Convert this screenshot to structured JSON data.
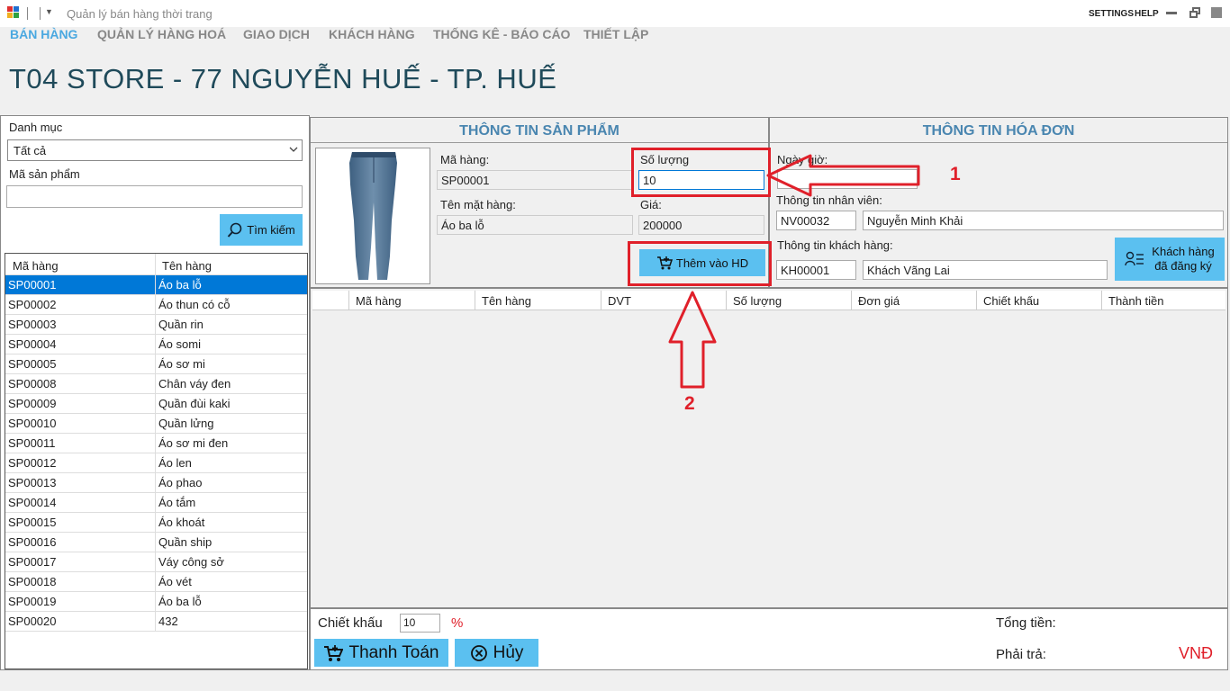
{
  "window": {
    "title": "Quản lý bán hàng thời trang",
    "settings_label": "SETTINGS",
    "help_label": "HELP"
  },
  "menu": [
    {
      "label": "BÁN HÀNG",
      "active": true
    },
    {
      "label": "QUẢN LÝ HÀNG HOÁ",
      "active": false
    },
    {
      "label": "GIAO DỊCH",
      "active": false
    },
    {
      "label": "KHÁCH HÀNG",
      "active": false
    },
    {
      "label": "THỐNG KÊ - BÁO CÁO",
      "active": false
    },
    {
      "label": "THIẾT LẬP",
      "active": false
    }
  ],
  "store_title": "T04 STORE - 77 NGUYỄN HUẾ - TP. HUẾ",
  "left": {
    "category_label": "Danh mục",
    "category_value": "Tất cả",
    "code_label": "Mã sản phẩm",
    "code_value": "",
    "search_button": "Tìm kiếm",
    "table": {
      "headers": [
        "Mã hàng",
        "Tên hàng"
      ],
      "rows": [
        [
          "SP00001",
          "Áo ba lỗ"
        ],
        [
          "SP00002",
          "Áo thun có cỗ"
        ],
        [
          "SP00003",
          "Quần rin"
        ],
        [
          "SP00004",
          "Áo somi"
        ],
        [
          "SP00005",
          "Áo sơ mi"
        ],
        [
          "SP00008",
          "Chân váy đen"
        ],
        [
          "SP00009",
          "Quần đùi kaki"
        ],
        [
          "SP00010",
          "Quần lửng"
        ],
        [
          "SP00011",
          "Áo sơ mi đen"
        ],
        [
          "SP00012",
          "Áo len"
        ],
        [
          "SP00013",
          "Áo phao"
        ],
        [
          "SP00014",
          "Áo tắm"
        ],
        [
          "SP00015",
          "Áo khoát"
        ],
        [
          "SP00016",
          "Quần ship"
        ],
        [
          "SP00017",
          "Váy công sở"
        ],
        [
          "SP00018",
          "Áo vét"
        ],
        [
          "SP00019",
          "Áo ba lỗ"
        ],
        [
          "SP00020",
          "432"
        ]
      ],
      "selected_index": 0
    }
  },
  "product": {
    "header": "THÔNG TIN SẢN PHẨM",
    "code_label": "Mã hàng:",
    "code_value": "SP00001",
    "qty_label": "Số lượng",
    "qty_value": "10",
    "name_label": "Tên mặt hàng:",
    "name_value": "Áo ba lỗ",
    "price_label": "Giá:",
    "price_value": "200000",
    "add_button": "Thêm vào HD"
  },
  "bill": {
    "header": "THÔNG TIN HÓA ĐƠN",
    "datetime_label": "Ngày giờ:",
    "datetime_value": "",
    "staff_label": "Thông tin nhân viên:",
    "staff_id": "NV00032",
    "staff_name": "Nguyễn Minh Khải",
    "customer_label": "Thông tin khách hàng:",
    "customer_id": "KH00001",
    "customer_name": "Khách Vãng Lai",
    "registered_button_line1": "Khách hàng",
    "registered_button_line2": "đã đăng ký"
  },
  "invoice_grid": {
    "headers": [
      "Mã hàng",
      "Tên hàng",
      "DVT",
      "Số lượng",
      "Đơn giá",
      "Chiết khấu",
      "Thành tiền"
    ]
  },
  "footer": {
    "discount_label": "Chiết khấu",
    "discount_value": "10",
    "percent_sign": "%",
    "pay_button": "Thanh Toán",
    "cancel_button": "Hủy",
    "total_label": "Tổng tiền:",
    "payable_label": "Phải trả:",
    "currency": "VNĐ"
  },
  "annotations": {
    "label_1": "1",
    "label_2": "2",
    "color": "#e0202a"
  }
}
